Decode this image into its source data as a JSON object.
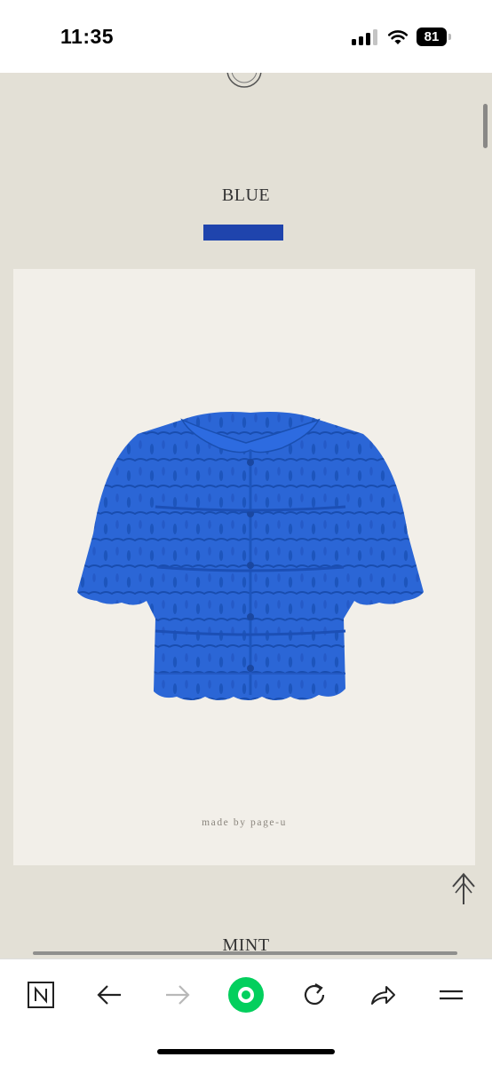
{
  "status_bar": {
    "time": "11:35",
    "battery_level": "81",
    "signal_bars_active": 3,
    "signal_bars_total": 4,
    "icons": [
      "cellular-signal-icon",
      "wifi-icon",
      "battery-icon"
    ]
  },
  "page": {
    "background_color": "#e3e0d6",
    "sections": [
      {
        "color_name": "BLUE",
        "swatch_color": "#1f44ad",
        "product_image": "blue short-sleeve crochet cardigan",
        "watermark": "made by page-u"
      },
      {
        "color_name": "MINT"
      }
    ],
    "scroll_to_top_icon": "arrow-up-icon"
  },
  "toolbar": {
    "items": [
      {
        "name": "naver-home-button",
        "icon": "naver-n-icon"
      },
      {
        "name": "back-button",
        "icon": "arrow-left-icon"
      },
      {
        "name": "forward-button",
        "icon": "arrow-right-icon",
        "disabled": true
      },
      {
        "name": "green-dot-button",
        "icon": "green-dot-icon",
        "color": "#03cf5d"
      },
      {
        "name": "reload-button",
        "icon": "reload-icon"
      },
      {
        "name": "share-button",
        "icon": "share-icon"
      },
      {
        "name": "menu-button",
        "icon": "menu-icon"
      }
    ]
  }
}
